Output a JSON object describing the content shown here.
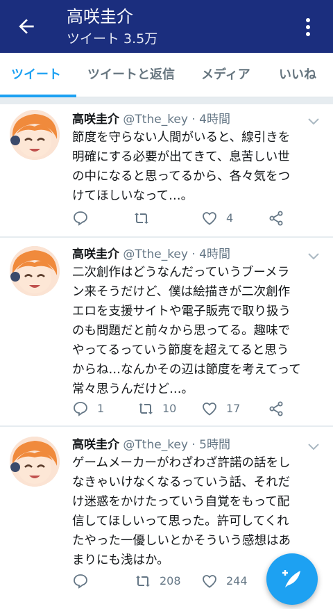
{
  "header": {
    "title": "高咲圭介",
    "subtitle": "ツイート 3.5万"
  },
  "tabs": [
    {
      "label": "ツイート",
      "active": true
    },
    {
      "label": "ツイートと返信",
      "active": false
    },
    {
      "label": "メディア",
      "active": false
    },
    {
      "label": "いいね",
      "active": false
    }
  ],
  "tweets": [
    {
      "name": "高咲圭介",
      "meta": "@Tthe_key · 4時間",
      "lines": [
        "節度を守らない人間がいると、線引きを",
        "明確にする必要が出てきて、息苦しい世",
        "の中になると思ってるから、各々気をつ",
        "けてほしいなって…。"
      ],
      "reply_count": "",
      "retweet_count": "",
      "like_count": "4"
    },
    {
      "name": "高咲圭介",
      "meta": "@Tthe_key · 4時間",
      "lines": [
        "二次創作はどうなんだっていうブーメラ",
        "ン来そうだけど、僕は絵描きが二次創作",
        "エロを支援サイトや電子販売で取り扱う",
        "のも問題だと前々から思ってる。趣味で",
        "やってるっていう節度を超えてると思う",
        "からね…なんかその辺は節度を考えてって",
        "常々思うんだけど…。"
      ],
      "reply_count": "1",
      "retweet_count": "10",
      "like_count": "17"
    },
    {
      "name": "高咲圭介",
      "meta": "@Tthe_key · 5時間",
      "lines": [
        "ゲームメーカーがわざわざ許諾の話をし",
        "なきゃいけなくなるっていう話、それだ",
        "け迷惑をかけたっていう自覚をもって配",
        "信してほしいって思った。許可してくれ",
        "たやった一優しいとかそういう感想はあ",
        "まりにも浅はか。"
      ],
      "reply_count": "",
      "retweet_count": "208",
      "like_count": "244"
    }
  ],
  "icons": {
    "back": "arrow-left-icon",
    "more": "kebab-menu-icon",
    "reply": "reply-icon",
    "retweet": "retweet-icon",
    "like": "heart-icon",
    "share": "share-icon",
    "compose": "compose-tweet-icon"
  },
  "colors": {
    "appbar": "#1b2e7e",
    "accent": "#1da1f2",
    "muted": "#657786"
  }
}
